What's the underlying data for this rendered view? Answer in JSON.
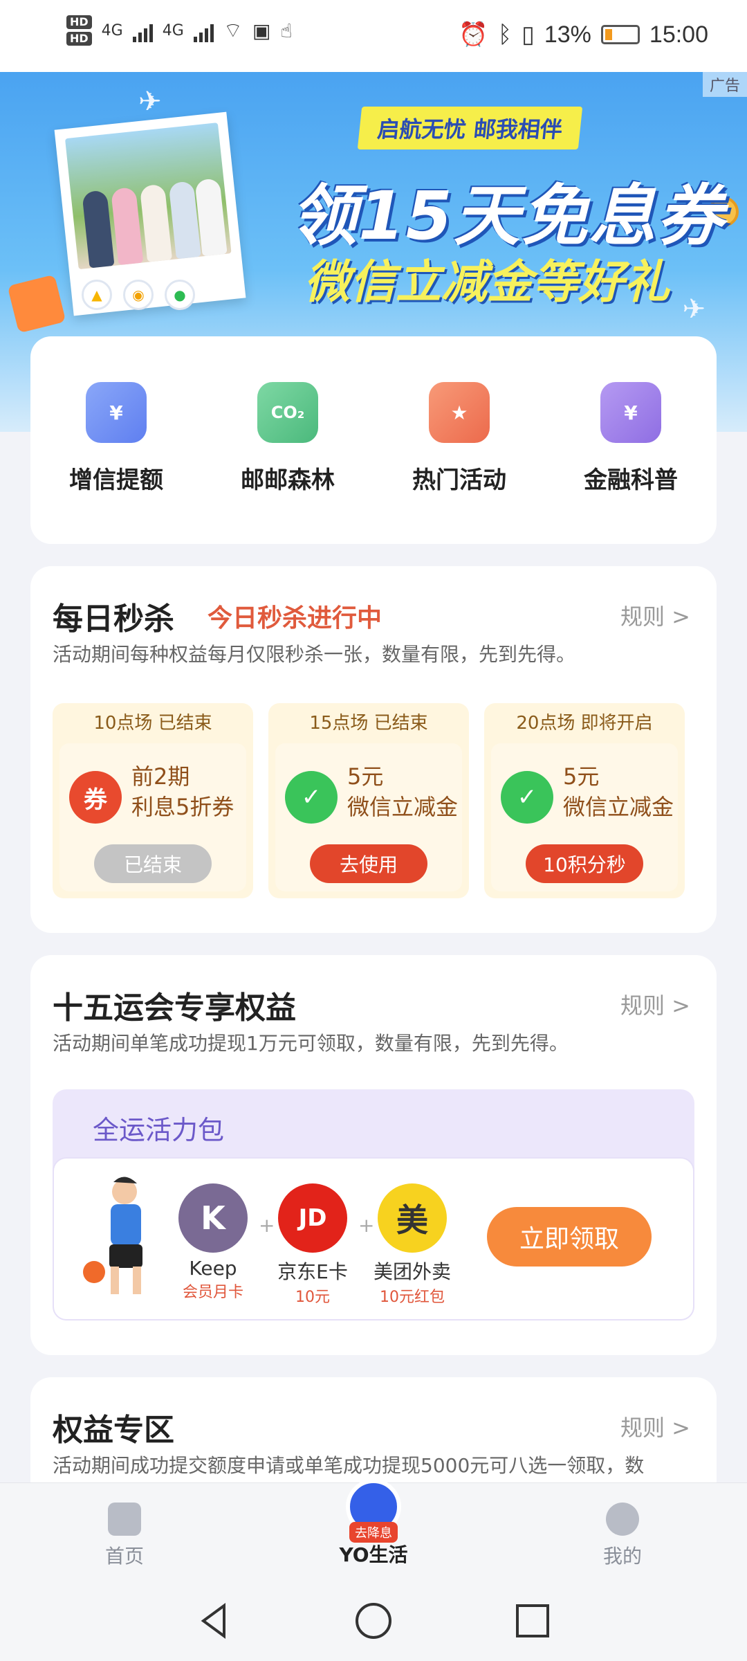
{
  "status_bar": {
    "hd1": "HD",
    "hd2": "HD",
    "net1": "4G",
    "net2": "4G",
    "battery": "13%",
    "time": "15:00"
  },
  "banner": {
    "ad_label": "广告",
    "slogan": "启航无忧 邮我相伴",
    "headline": "领15天免息券",
    "subline": "微信立减金等好礼"
  },
  "quick_entries": [
    {
      "label": "增信提额",
      "icon": "wallet-icon",
      "color": "#6c8ff5"
    },
    {
      "label": "邮邮森林",
      "icon": "co2-cloud-icon",
      "color": "#5cc48a"
    },
    {
      "label": "热门活动",
      "icon": "bookmark-star-icon",
      "color": "#f27b5a"
    },
    {
      "label": "金融科普",
      "icon": "finance-search-icon",
      "color": "#9b7ae8"
    }
  ],
  "flash_sale": {
    "title": "每日秒杀",
    "tag": "今日秒杀进行中",
    "rule": "规则 >",
    "desc": "活动期间每种权益每月仅限秒杀一张，数量有限，先到先得。",
    "slots": [
      {
        "session": "10点场 已结束",
        "line1": "前2期",
        "line2": "利息5折券",
        "button": "已结束",
        "button_color": "#c4c4c4",
        "icon_text": "券",
        "icon_color": "#e84a2e"
      },
      {
        "session": "15点场 已结束",
        "line1": "5元",
        "line2": "微信立减金",
        "button": "去使用",
        "button_color": "#e2462b",
        "icon_text": "✓",
        "icon_color": "#3ac45a"
      },
      {
        "session": "20点场 即将开启",
        "line1": "5元",
        "line2": "微信立减金",
        "button": "10积分秒",
        "button_color": "#e2462b",
        "icon_text": "✓",
        "icon_color": "#3ac45a"
      }
    ]
  },
  "games_benefit": {
    "title": "十五运会专享权益",
    "rule": "规则 >",
    "desc": "活动期间单笔成功提现1万元可领取，数量有限，先到先得。",
    "pack_title": "全运活力包",
    "rewards": [
      {
        "name": "Keep",
        "sub": "会员月卡",
        "logo": "K",
        "color": "#7a6a94"
      },
      {
        "name": "京东E卡",
        "sub": "10元",
        "logo": "JD",
        "color": "#e2231a"
      },
      {
        "name": "美团外卖",
        "sub": "10元红包",
        "logo": "美",
        "color": "#f7d21f"
      }
    ],
    "claim_button": "立即领取"
  },
  "benefit_zone": {
    "title": "权益专区",
    "rule": "规则 >",
    "desc": "活动期间成功提交额度申请或单笔成功提现5000元可八选一领取，数"
  },
  "bottom_nav": {
    "home": "首页",
    "yo_life": "YO生活",
    "yo_badge": "去降息",
    "mine": "我的"
  }
}
